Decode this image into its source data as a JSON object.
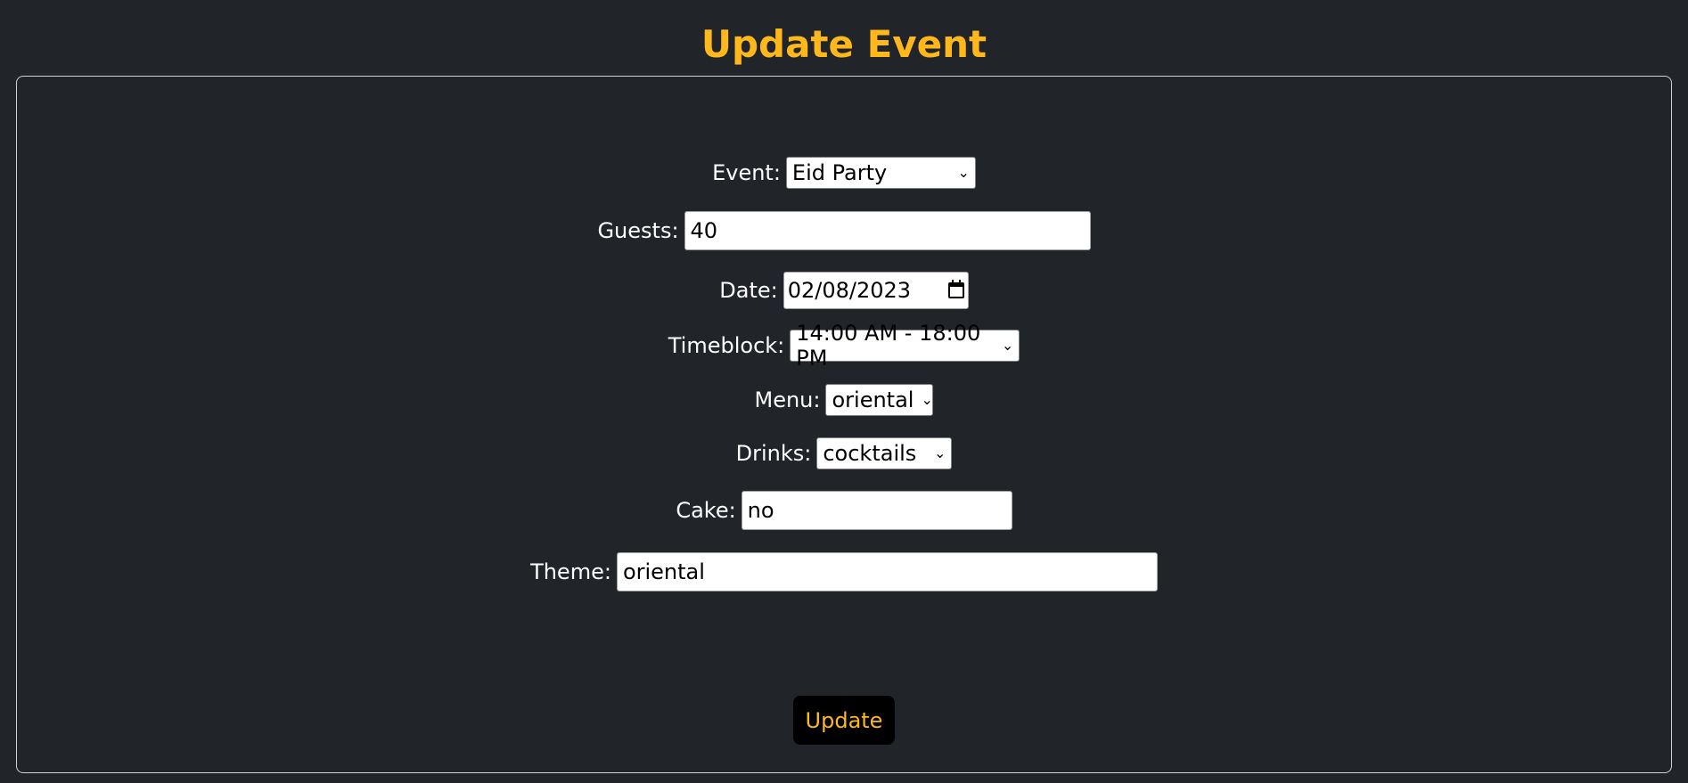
{
  "header": {
    "title": "Update Event"
  },
  "form": {
    "event": {
      "label": "Event:",
      "value": "Eid Party"
    },
    "guests": {
      "label": "Guests:",
      "value": "40"
    },
    "date": {
      "label": "Date:",
      "value": "02/08/2023"
    },
    "timeblock": {
      "label": "Timeblock:",
      "value": "14:00 AM - 18:00 PM"
    },
    "menu": {
      "label": "Menu:",
      "value": "oriental"
    },
    "drinks": {
      "label": "Drinks:",
      "value": "cocktails"
    },
    "cake": {
      "label": "Cake:",
      "value": "no"
    },
    "theme": {
      "label": "Theme:",
      "value": "oriental"
    },
    "submit_label": "Update"
  },
  "icons": {
    "dropdown": "chevron-down-icon",
    "date_picker": "calendar-icon"
  },
  "colors": {
    "background": "#212429",
    "accent": "#ffb81c",
    "button_background": "#000000",
    "card_border": "#cfd2d6"
  }
}
